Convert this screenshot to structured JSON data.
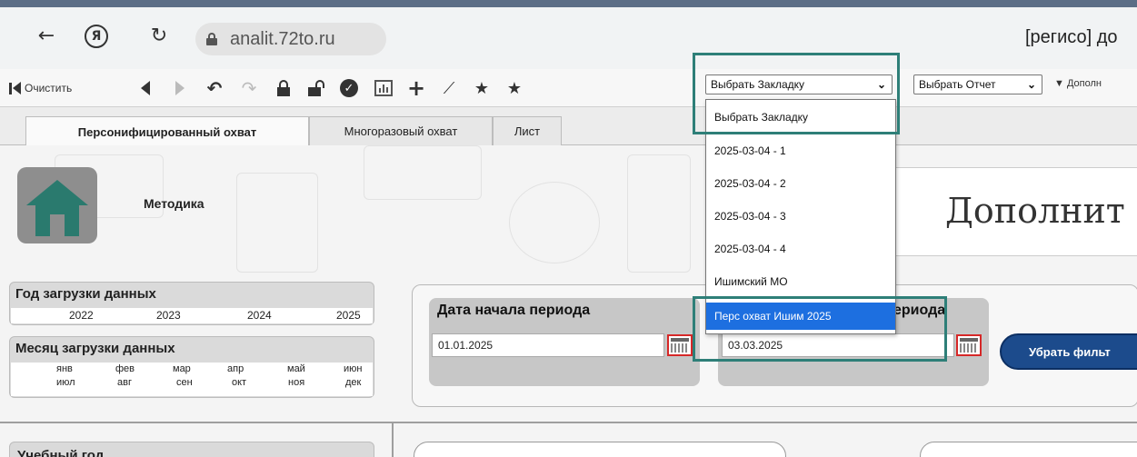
{
  "browser": {
    "address": "analit.72to.ru",
    "page_title": "[регисо] до",
    "yandex_label": "Я"
  },
  "toolbar": {
    "clear_label": "Очистить",
    "bookmark_select": "Выбрать Закладку",
    "report_select": "Выбрать Отчет",
    "more_label": "Дополн"
  },
  "tabs": [
    {
      "label": "Персонифицированный охват",
      "active": true
    },
    {
      "label": "Многоразовый охват",
      "active": false
    },
    {
      "label": "Лист",
      "active": false
    }
  ],
  "main": {
    "methodology": "Методика",
    "big_title": "Дополнит",
    "load_year": {
      "title": "Год загрузки данных",
      "years": [
        "2022",
        "2023",
        "2024",
        "2025"
      ]
    },
    "load_month": {
      "title": "Месяц загрузки данных",
      "row1": [
        "янв",
        "фев",
        "мар",
        "апр",
        "май",
        "июн"
      ],
      "row2": [
        "июл",
        "авг",
        "сен",
        "окт",
        "ноя",
        "дек"
      ]
    },
    "period_start": {
      "label": "Дата начала периода",
      "value": "01.01.2025"
    },
    "period_end": {
      "label_fragment": "ериода",
      "value": "03.03.2025"
    },
    "remove_filters": "Убрать фильт",
    "study_year": "Учебный год"
  },
  "dropdown": {
    "items": [
      "Выбрать Закладку",
      "2025-03-04 - 1",
      "2025-03-04 - 2",
      "2025-03-04 - 3",
      "2025-03-04 - 4",
      "Ишимский МО",
      "Перс охват Ишим 2025"
    ],
    "selected_index": 6
  },
  "colors": {
    "highlight": "#2e7f78",
    "selected_item": "#1d6fe0",
    "button_blue": "#1c4b8c",
    "home_icon": "#2a7a6e"
  }
}
